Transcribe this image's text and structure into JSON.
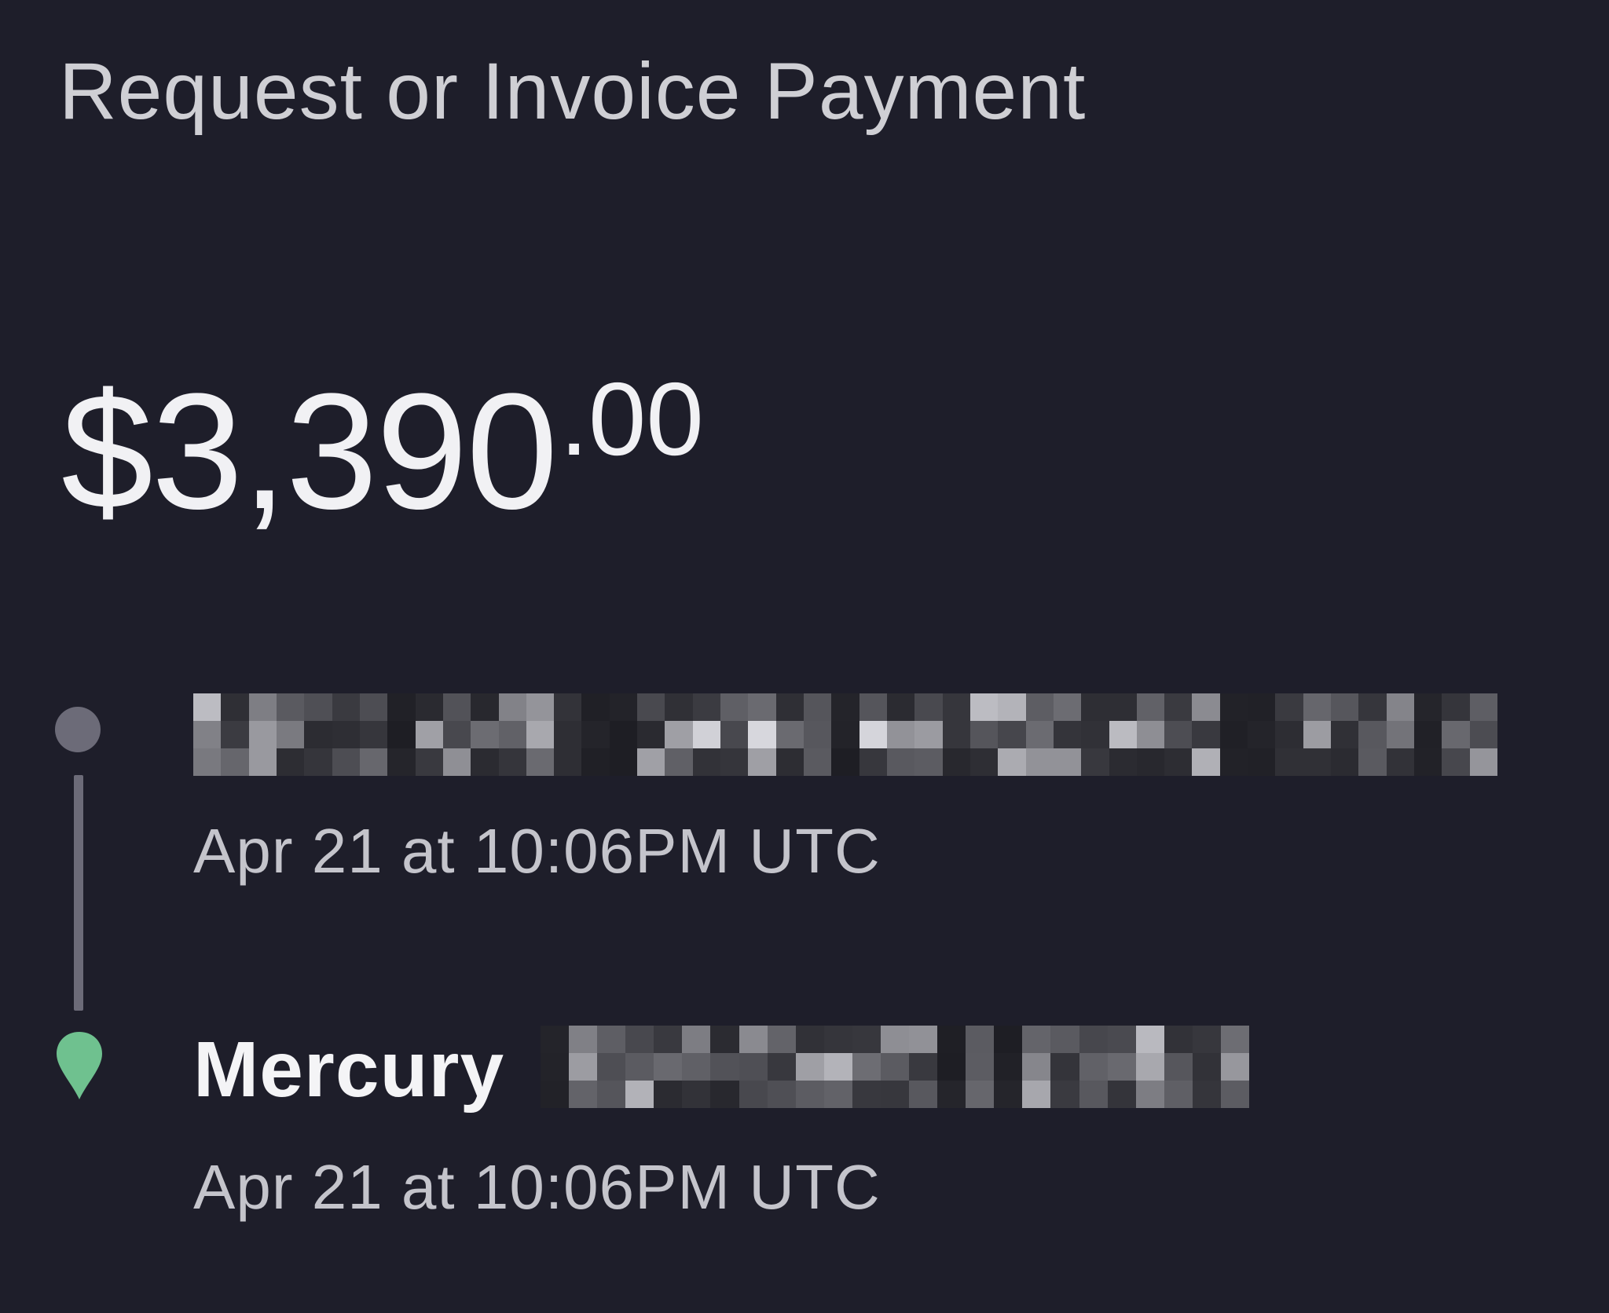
{
  "header": {
    "title": "Request or Invoice Payment"
  },
  "amount": {
    "whole": "$3,390",
    "cents": ".00"
  },
  "timeline": {
    "origin": {
      "time": "Apr 21 at 10:06PM UTC",
      "marker_color": "#6c6b78"
    },
    "destination": {
      "name": "Mercury",
      "time": "Apr 21 at 10:06PM UTC",
      "marker_color": "#6fc18f"
    }
  },
  "colors": {
    "background": "#1e1e2a",
    "connector": "#6c6b78",
    "accent_green": "#6fc18f"
  }
}
